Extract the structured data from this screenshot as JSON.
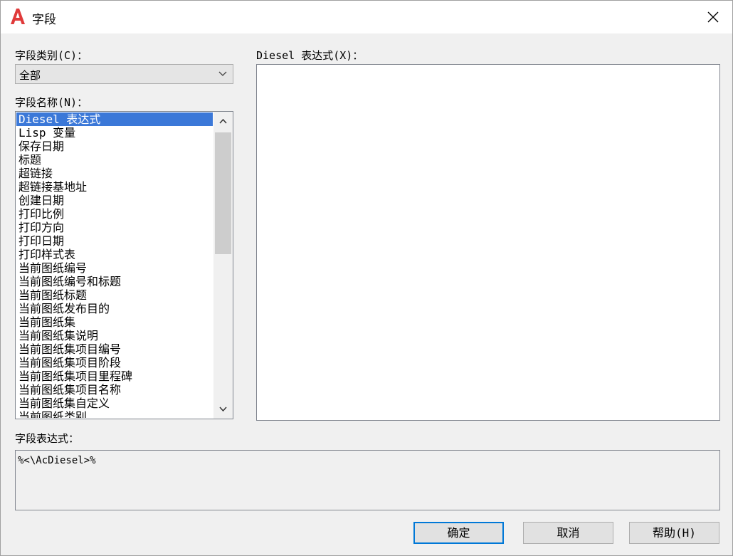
{
  "window": {
    "title": "字段",
    "logo_letter": "A",
    "colors": {
      "logo": "#e03a3a",
      "selection": "#3b78d8",
      "default_button_border": "#0078d7"
    }
  },
  "field_category": {
    "label": "字段类别(C)：",
    "value": "全部"
  },
  "field_names": {
    "label": "字段名称(N)：",
    "items": [
      "Diesel 表达式",
      "Lisp 变量",
      "保存日期",
      "标题",
      "超链接",
      "超链接基地址",
      "创建日期",
      "打印比例",
      "打印方向",
      "打印日期",
      "打印样式表",
      "当前图纸编号",
      "当前图纸编号和标题",
      "当前图纸标题",
      "当前图纸发布目的",
      "当前图纸集",
      "当前图纸集说明",
      "当前图纸集项目编号",
      "当前图纸集项目阶段",
      "当前图纸集项目里程碑",
      "当前图纸集项目名称",
      "当前图纸集自定义",
      "当前图纸类别"
    ],
    "selected_index": 0
  },
  "diesel": {
    "label": "Diesel 表达式(X)："
  },
  "field_expression": {
    "label": "字段表达式：",
    "value": "%<\\AcDiesel>%"
  },
  "buttons": {
    "ok": "确定",
    "cancel": "取消",
    "help": "帮助(H)"
  }
}
